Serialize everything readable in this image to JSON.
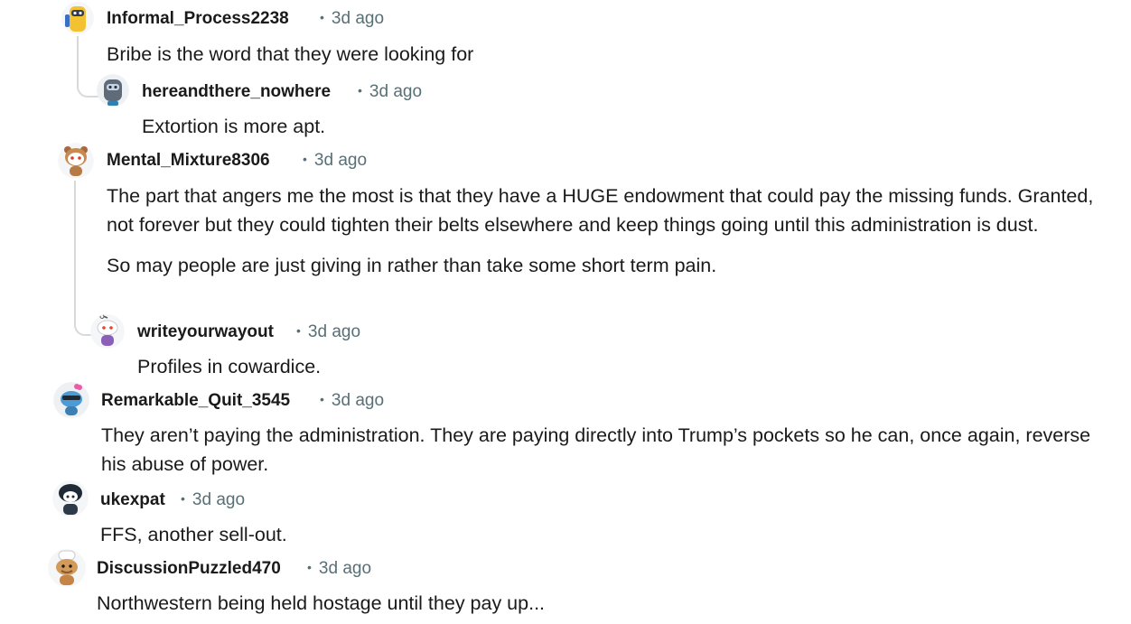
{
  "comments": [
    {
      "user": "Informal_Process2238",
      "time": "3d ago",
      "text": [
        "Bribe is the word that they were looking for"
      ],
      "avatar": "robot-yellow-avatar"
    },
    {
      "user": "hereandthere_nowhere",
      "time": "3d ago",
      "text": [
        "Extortion is more apt."
      ],
      "avatar": "robot-gray-avatar"
    },
    {
      "user": "Mental_Mixture8306",
      "time": "3d ago",
      "text": [
        "The part that angers me the most is that they have a HUGE endowment that could pay the missing funds. Granted, not forever but they could tighten their belts elsewhere and keep things going until this administration is dust.",
        "So may people are just giving in rather than take some short term pain."
      ],
      "avatar": "snoo-brown-avatar"
    },
    {
      "user": "writeyourwayout",
      "time": "3d ago",
      "text": [
        "Profiles in cowardice."
      ],
      "avatar": "snoo-default-avatar"
    },
    {
      "user": "Remarkable_Quit_3545",
      "time": "3d ago",
      "text": [
        "They aren’t paying the administration. They are paying directly into Trump’s pockets so he can, once again, reverse his abuse of power."
      ],
      "avatar": "snoo-blue-avatar"
    },
    {
      "user": "ukexpat",
      "time": "3d ago",
      "text": [
        "FFS, another sell-out."
      ],
      "avatar": "snoo-dark-avatar"
    },
    {
      "user": "DiscussionPuzzled470",
      "time": "3d ago",
      "text": [
        "Northwestern being held hostage until they pay up..."
      ],
      "avatar": "snoo-chef-avatar"
    }
  ],
  "colors": {
    "text": "#1a1a1b",
    "meta": "#576f76",
    "thread": "#d6dadc"
  }
}
